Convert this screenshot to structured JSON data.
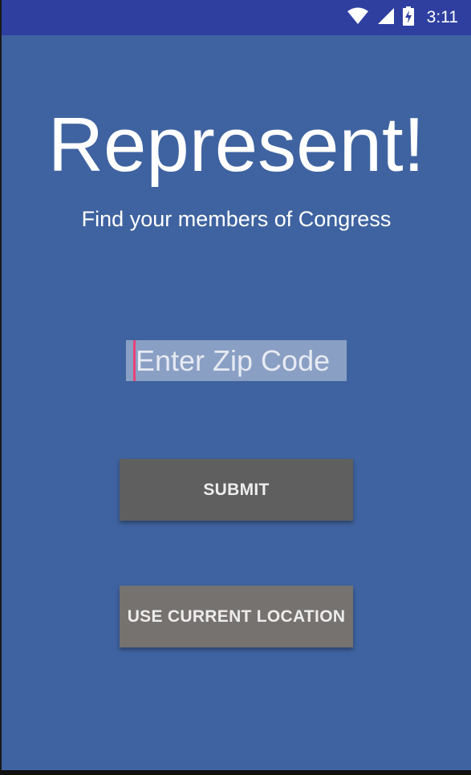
{
  "status_bar": {
    "time": "3:11",
    "icons": [
      "wifi-icon",
      "signal-icon",
      "battery-charging-icon"
    ],
    "color": "#2E3FA0"
  },
  "main": {
    "title": "Represent!",
    "subtitle": "Find your members of Congress",
    "zip": {
      "placeholder": "Enter Zip Code",
      "value": ""
    },
    "submit_label": "SUBMIT",
    "location_label": "USE CURRENT LOCATION",
    "background_color": "#3F63A0",
    "accent_color": "#E8437A"
  }
}
